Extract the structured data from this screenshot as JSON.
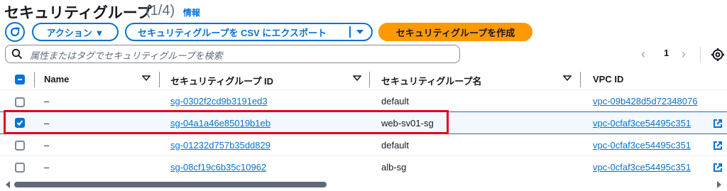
{
  "header": {
    "title": "セキュリティグループ",
    "count": "(1/4)",
    "info_link": "情報"
  },
  "toolbar": {
    "refresh_icon": "refresh-icon",
    "actions_label": "アクション ▼",
    "export_label": "セキュリティグループを CSV にエクスポート",
    "create_label": "セキュリティグループを作成",
    "accent_color": "#0972d3",
    "primary_color": "#ff9900"
  },
  "search": {
    "placeholder": "属性またはタグでセキュリティグループを検索"
  },
  "pagination": {
    "current_page": "1",
    "prev_label": "‹",
    "next_label": "›"
  },
  "table": {
    "columns": [
      "Name",
      "セキュリティグループ ID",
      "セキュリティグループ名",
      "VPC ID"
    ],
    "rows": [
      {
        "selected": false,
        "name": "–",
        "sg_id": "sg-0302f2cd9b3191ed3",
        "sg_name": "default",
        "vpc_id": "vpc-09b428d5d72348076"
      },
      {
        "selected": true,
        "name": "–",
        "sg_id": "sg-04a1a46e85019b1eb",
        "sg_name": "web-sv01-sg",
        "vpc_id": "vpc-0cfaf3ce54495c351"
      },
      {
        "selected": false,
        "name": "–",
        "sg_id": "sg-01232d757b35dd829",
        "sg_name": "default",
        "vpc_id": "vpc-0cfaf3ce54495c351"
      },
      {
        "selected": false,
        "name": "–",
        "sg_id": "sg-08cf19c6b35c10962",
        "sg_name": "alb-sg",
        "vpc_id": "vpc-0cfaf3ce54495c351"
      }
    ],
    "highlight_color": "#e4001b"
  }
}
